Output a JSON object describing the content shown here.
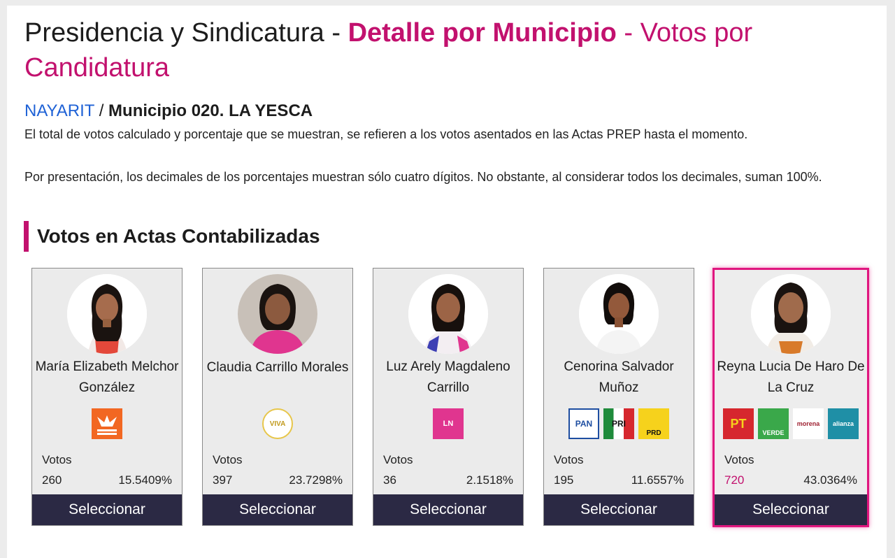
{
  "header": {
    "title_part1": "Presidencia y Sindicatura - ",
    "title_part2": "Detalle por Municipio",
    "title_part3": " - Votos por Candidatura"
  },
  "breadcrumb": {
    "state": "NAYARIT",
    "separator": " / ",
    "municipality": "Municipio 020. LA YESCA"
  },
  "notes": [
    "El total de votos calculado y porcentaje que se muestran, se refieren a los votos asentados en las Actas PREP hasta el momento.",
    "Por presentación, los decimales de los porcentajes muestran sólo cuatro dígitos. No obstante, al considerar todos los decimales, suman 100%."
  ],
  "section_title": "Votos en Actas Contabilizadas",
  "votes_label": "Votos",
  "select_label": "Seleccionar",
  "candidates": [
    {
      "name": "María Elizabeth Melchor González",
      "votes": "260",
      "percent": "15.5409%",
      "parties": [
        "MOVIMIENTO CIUDADANO"
      ]
    },
    {
      "name": "Claudia Carrillo Morales",
      "votes": "397",
      "percent": "23.7298%",
      "parties": [
        "VIVA"
      ]
    },
    {
      "name": "Luz Arely Magdaleno Carrillo",
      "votes": "36",
      "percent": "2.1518%",
      "parties": [
        "LN"
      ]
    },
    {
      "name": "Cenorina Salvador Muñoz",
      "votes": "195",
      "percent": "11.6557%",
      "parties": [
        "PAN",
        "PRI",
        "PRD"
      ]
    },
    {
      "name": "Reyna Lucia De Haro De La Cruz",
      "votes": "720",
      "percent": "43.0364%",
      "parties": [
        "PT",
        "VERDE",
        "morena",
        "alianza"
      ],
      "selected": true
    }
  ],
  "colors": {
    "accent": "#c2116e",
    "link": "#1f62d6",
    "button_bg": "#2b2944",
    "selected_border": "#e0167f"
  }
}
